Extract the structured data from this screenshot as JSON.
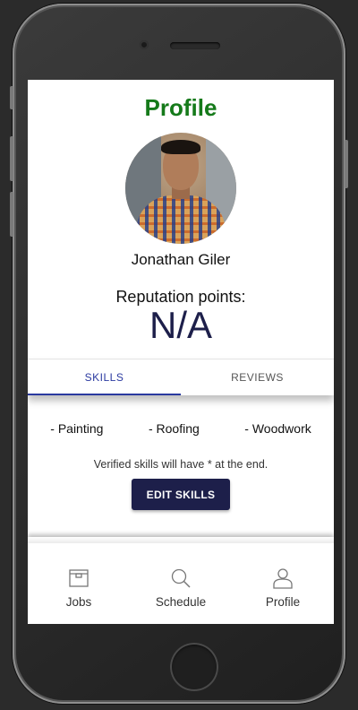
{
  "header": {
    "title": "Profile"
  },
  "profile": {
    "name": "Jonathan Giler",
    "reputation_label": "Reputation points:",
    "reputation_value": "N/A"
  },
  "tabs": [
    {
      "label": "SKILLS",
      "active": true
    },
    {
      "label": "REVIEWS",
      "active": false
    }
  ],
  "skills": {
    "items": [
      "- Painting",
      "- Roofing",
      "- Woodwork"
    ],
    "note": "Verified skills will have * at the end.",
    "edit_label": "EDIT SKILLS"
  },
  "bottom_nav": [
    {
      "label": "Jobs",
      "icon": "briefcase-icon"
    },
    {
      "label": "Schedule",
      "icon": "search-icon"
    },
    {
      "label": "Profile",
      "icon": "person-icon"
    }
  ],
  "colors": {
    "title": "#157a1a",
    "accent": "#2b3aa0",
    "button": "#1d1f4a"
  }
}
